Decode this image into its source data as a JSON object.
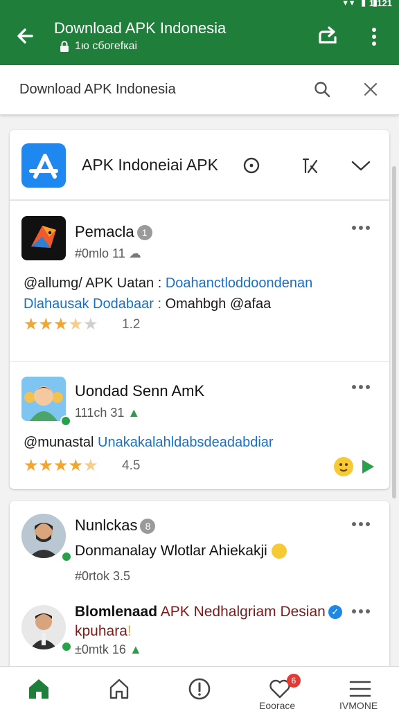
{
  "status_bar": {
    "icons": "▾▾ ▮ ▮",
    "time": "1:121"
  },
  "app_bar": {
    "title": "Download APK Indonesia",
    "subtitle": "1ю сбогеfкаi"
  },
  "search": {
    "query": "Download APK Indonesia"
  },
  "card_header": {
    "title": "APK Indoneiai APK"
  },
  "posts": [
    {
      "name": "Pemacla",
      "badge": "1",
      "meta": "#0mlo 11",
      "line1_handle": "@allumg/ APK Uatan :",
      "line1_link": "Doahanctloddoondenan",
      "line2_a": "Dlahausak Dodabaar :",
      "line2_b": "Omahbgh @afaa",
      "rating": 3.5,
      "rating_text": "1.2"
    },
    {
      "name": "Uondad Senn AmK",
      "meta": "111ch 31",
      "line1_handle": "@munastal",
      "line1_link": "Unakakalahldabsdeadabdiar",
      "rating": 4.5,
      "rating_text": "4.5"
    },
    {
      "name": "Nunlckas",
      "badge": "8",
      "text": "Donmanalay Wlotlar Ahiekakji",
      "meta": "#0rtok 3.5"
    },
    {
      "name": "Blomlenaad",
      "name_rest": "APK Nedhalgriam Desian",
      "name_line2": "kpuhara",
      "badge": "✓",
      "meta": "±0mtk 16"
    }
  ],
  "bottom_nav": {
    "badge_count": "6",
    "labels": [
      "Eoorace",
      "IVMONE"
    ]
  },
  "colors": {
    "primary": "#1f7f3a",
    "link": "#1a6fc4",
    "star": "#f2a531"
  }
}
